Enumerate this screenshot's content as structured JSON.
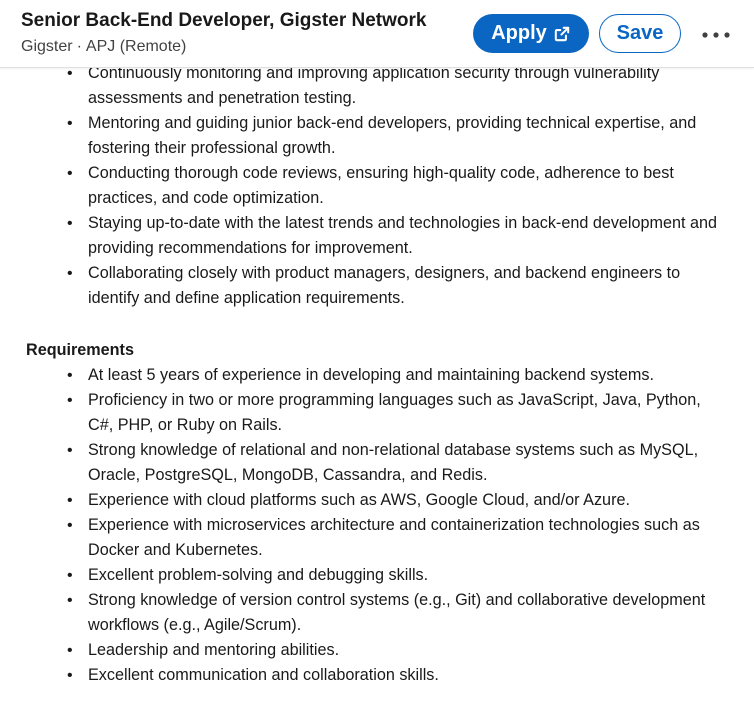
{
  "header": {
    "title": "Senior Back-End Developer, Gigster Network",
    "company": "Gigster",
    "separator": "·",
    "location": "APJ (Remote)",
    "apply_label": "Apply",
    "save_label": "Save",
    "more_icon": "ellipsis-icon",
    "apply_icon": "external-link-icon"
  },
  "colors": {
    "brand": "#0a66c2",
    "text": "#191919"
  },
  "responsibilities": [
    " Continuously monitoring and improving application security through vulnerability assessments and penetration testing.",
    " Mentoring and guiding junior back-end developers, providing technical expertise, and fostering their professional growth.",
    " Conducting thorough code reviews, ensuring high-quality code, adherence to best practices, and code optimization.",
    " Staying up-to-date with the latest trends and technologies in back-end development and providing recommendations for improvement.",
    " Collaborating closely with product managers, designers, and backend engineers to identify and define application requirements."
  ],
  "requirements_heading": "Requirements",
  "requirements": [
    " At least 5 years of experience in developing and maintaining backend systems.",
    " Proficiency in two or more programming languages such as JavaScript, Java, Python, C#, PHP, or Ruby on Rails.",
    " Strong knowledge of relational and non-relational database systems such as MySQL, Oracle, PostgreSQL, MongoDB, Cassandra, and Redis.",
    " Experience with cloud platforms such as AWS, Google Cloud, and/or Azure.",
    " Experience with microservices architecture and containerization technologies such as Docker and Kubernetes.",
    " Excellent problem-solving and debugging skills.",
    " Strong knowledge of version control systems (e.g., Git) and collaborative development workflows (e.g., Agile/Scrum).",
    " Leadership and mentoring abilities.",
    " Excellent communication and collaboration skills."
  ],
  "bullet": "•"
}
